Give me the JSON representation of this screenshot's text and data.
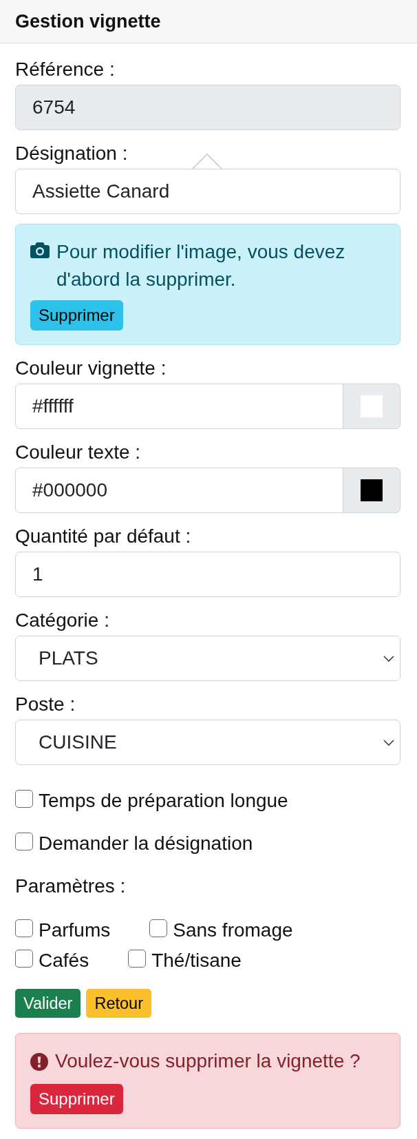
{
  "panel": {
    "title": "Gestion vignette"
  },
  "form": [
    {
      "kind": "text",
      "label": "Référence :",
      "value": "6754",
      "disabled": true,
      "popover": false
    },
    {
      "kind": "text",
      "label": "Désignation :",
      "value": "Assiette Canard",
      "disabled": false,
      "popover": true
    },
    {
      "kind": "alert",
      "message": "Pour modifier l'image, vous devez d'abord la supprimer.",
      "button": "Supprimer"
    },
    {
      "kind": "color",
      "label": "Couleur vignette :",
      "value": "#ffffff",
      "color": "#ffffff"
    },
    {
      "kind": "color",
      "label": "Couleur texte :",
      "value": "#000000",
      "color": "#000000"
    },
    {
      "kind": "text",
      "label": "Quantité par défaut :",
      "value": "1",
      "disabled": false,
      "popover": false
    },
    {
      "kind": "select",
      "label": "Catégorie :",
      "value": "PLATS"
    },
    {
      "kind": "select",
      "label": "Poste :",
      "value": "CUISINE"
    }
  ],
  "options": [
    {
      "label": "Temps de préparation longue",
      "checked": false
    },
    {
      "label": "Demander la désignation",
      "checked": false
    }
  ],
  "parameters": {
    "label": "Paramètres :",
    "rows": [
      [
        {
          "label": "Parfums",
          "checked": false
        },
        {
          "label": "Sans fromage",
          "checked": false
        }
      ],
      [
        {
          "label": "Cafés",
          "checked": false
        },
        {
          "label": "Thé/tisane",
          "checked": false
        }
      ]
    ]
  },
  "actions": [
    {
      "label": "Valider",
      "kind": "success"
    },
    {
      "label": "Retour",
      "kind": "warning"
    }
  ],
  "delete_alert": {
    "message": "Voulez-vous supprimer la vignette ?",
    "button": "Supprimer"
  }
}
